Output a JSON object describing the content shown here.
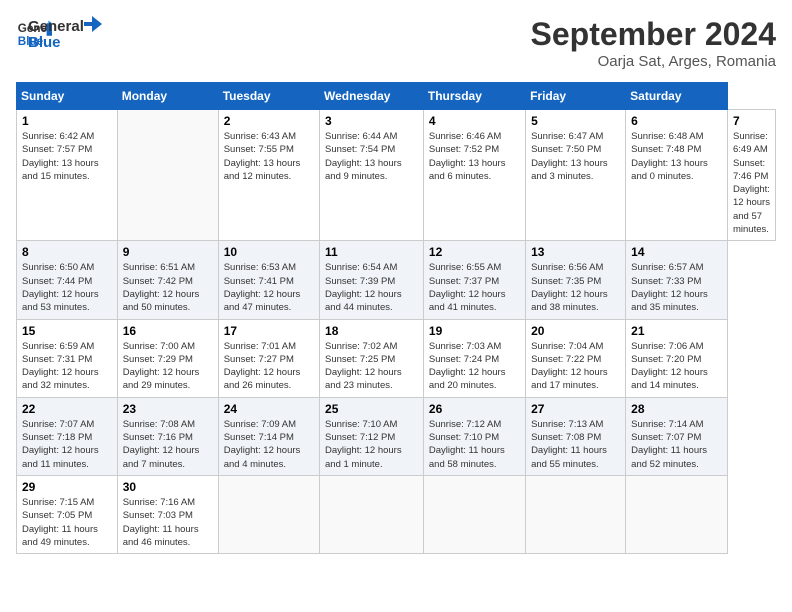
{
  "header": {
    "logo_line1": "General",
    "logo_line2": "Blue",
    "month_year": "September 2024",
    "location": "Oarja Sat, Arges, Romania"
  },
  "calendar": {
    "days_of_week": [
      "Sunday",
      "Monday",
      "Tuesday",
      "Wednesday",
      "Thursday",
      "Friday",
      "Saturday"
    ],
    "weeks": [
      [
        null,
        {
          "day": 2,
          "sunrise": "6:43 AM",
          "sunset": "7:55 PM",
          "daylight": "13 hours and 12 minutes."
        },
        {
          "day": 3,
          "sunrise": "6:44 AM",
          "sunset": "7:54 PM",
          "daylight": "13 hours and 9 minutes."
        },
        {
          "day": 4,
          "sunrise": "6:46 AM",
          "sunset": "7:52 PM",
          "daylight": "13 hours and 6 minutes."
        },
        {
          "day": 5,
          "sunrise": "6:47 AM",
          "sunset": "7:50 PM",
          "daylight": "13 hours and 3 minutes."
        },
        {
          "day": 6,
          "sunrise": "6:48 AM",
          "sunset": "7:48 PM",
          "daylight": "13 hours and 0 minutes."
        },
        {
          "day": 7,
          "sunrise": "6:49 AM",
          "sunset": "7:46 PM",
          "daylight": "12 hours and 57 minutes."
        }
      ],
      [
        {
          "day": 8,
          "sunrise": "6:50 AM",
          "sunset": "7:44 PM",
          "daylight": "12 hours and 53 minutes."
        },
        {
          "day": 9,
          "sunrise": "6:51 AM",
          "sunset": "7:42 PM",
          "daylight": "12 hours and 50 minutes."
        },
        {
          "day": 10,
          "sunrise": "6:53 AM",
          "sunset": "7:41 PM",
          "daylight": "12 hours and 47 minutes."
        },
        {
          "day": 11,
          "sunrise": "6:54 AM",
          "sunset": "7:39 PM",
          "daylight": "12 hours and 44 minutes."
        },
        {
          "day": 12,
          "sunrise": "6:55 AM",
          "sunset": "7:37 PM",
          "daylight": "12 hours and 41 minutes."
        },
        {
          "day": 13,
          "sunrise": "6:56 AM",
          "sunset": "7:35 PM",
          "daylight": "12 hours and 38 minutes."
        },
        {
          "day": 14,
          "sunrise": "6:57 AM",
          "sunset": "7:33 PM",
          "daylight": "12 hours and 35 minutes."
        }
      ],
      [
        {
          "day": 15,
          "sunrise": "6:59 AM",
          "sunset": "7:31 PM",
          "daylight": "12 hours and 32 minutes."
        },
        {
          "day": 16,
          "sunrise": "7:00 AM",
          "sunset": "7:29 PM",
          "daylight": "12 hours and 29 minutes."
        },
        {
          "day": 17,
          "sunrise": "7:01 AM",
          "sunset": "7:27 PM",
          "daylight": "12 hours and 26 minutes."
        },
        {
          "day": 18,
          "sunrise": "7:02 AM",
          "sunset": "7:25 PM",
          "daylight": "12 hours and 23 minutes."
        },
        {
          "day": 19,
          "sunrise": "7:03 AM",
          "sunset": "7:24 PM",
          "daylight": "12 hours and 20 minutes."
        },
        {
          "day": 20,
          "sunrise": "7:04 AM",
          "sunset": "7:22 PM",
          "daylight": "12 hours and 17 minutes."
        },
        {
          "day": 21,
          "sunrise": "7:06 AM",
          "sunset": "7:20 PM",
          "daylight": "12 hours and 14 minutes."
        }
      ],
      [
        {
          "day": 22,
          "sunrise": "7:07 AM",
          "sunset": "7:18 PM",
          "daylight": "12 hours and 11 minutes."
        },
        {
          "day": 23,
          "sunrise": "7:08 AM",
          "sunset": "7:16 PM",
          "daylight": "12 hours and 7 minutes."
        },
        {
          "day": 24,
          "sunrise": "7:09 AM",
          "sunset": "7:14 PM",
          "daylight": "12 hours and 4 minutes."
        },
        {
          "day": 25,
          "sunrise": "7:10 AM",
          "sunset": "7:12 PM",
          "daylight": "12 hours and 1 minute."
        },
        {
          "day": 26,
          "sunrise": "7:12 AM",
          "sunset": "7:10 PM",
          "daylight": "11 hours and 58 minutes."
        },
        {
          "day": 27,
          "sunrise": "7:13 AM",
          "sunset": "7:08 PM",
          "daylight": "11 hours and 55 minutes."
        },
        {
          "day": 28,
          "sunrise": "7:14 AM",
          "sunset": "7:07 PM",
          "daylight": "11 hours and 52 minutes."
        }
      ],
      [
        {
          "day": 29,
          "sunrise": "7:15 AM",
          "sunset": "7:05 PM",
          "daylight": "11 hours and 49 minutes."
        },
        {
          "day": 30,
          "sunrise": "7:16 AM",
          "sunset": "7:03 PM",
          "daylight": "11 hours and 46 minutes."
        },
        null,
        null,
        null,
        null,
        null
      ]
    ],
    "week1_day1": {
      "day": 1,
      "sunrise": "6:42 AM",
      "sunset": "7:57 PM",
      "daylight": "13 hours and 15 minutes."
    }
  }
}
